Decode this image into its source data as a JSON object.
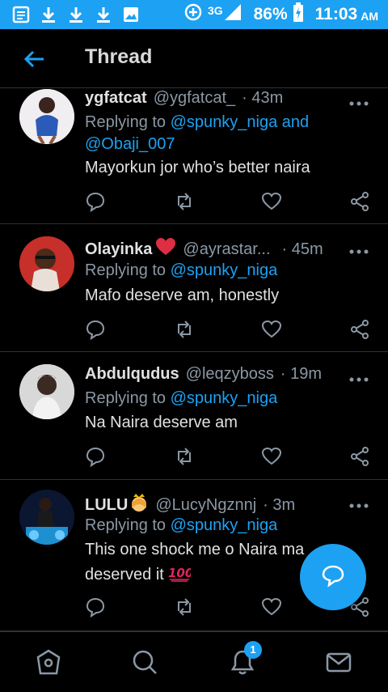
{
  "status_bar": {
    "network": "3G",
    "battery": "86%",
    "time": "11:03",
    "ampm": "AM",
    "accent": "#1DA1F2"
  },
  "header": {
    "title": "Thread"
  },
  "tweets": [
    {
      "name": "ygfatcat",
      "handle": "@ygfatcat_",
      "time": "· 43m",
      "reply_prefix": "Replying to",
      "reply_line1_mention": "@spunky_niga",
      "reply_line1_rest": " and",
      "reply_line2_mention": "@Obaji_007",
      "text": "Mayorkun jor who’s better naira"
    },
    {
      "name": "Olayinka",
      "emoji": "❤️",
      "handle": "@ayrastar...",
      "time": "· 45m",
      "reply_prefix": "Replying to",
      "reply_mention": "@spunky_niga",
      "text": "Mafo deserve am, honestly"
    },
    {
      "name": "Abdulqudus",
      "handle": "@leqzyboss",
      "time": "· 19m",
      "reply_prefix": "Replying to",
      "reply_mention": "@spunky_niga",
      "text": "Na Naira deserve am"
    },
    {
      "name": "LULU",
      "emoji": "👸",
      "handle": "@LucyNgznnj",
      "time": "· 3m",
      "reply_prefix": "Replying to",
      "reply_mention": "@spunky_niga",
      "text_line1": "This one shock me o Naira ma",
      "text_line2": "deserved it",
      "text_emoji": "💯"
    }
  ],
  "bottom_nav": {
    "notifications_badge": "1"
  }
}
